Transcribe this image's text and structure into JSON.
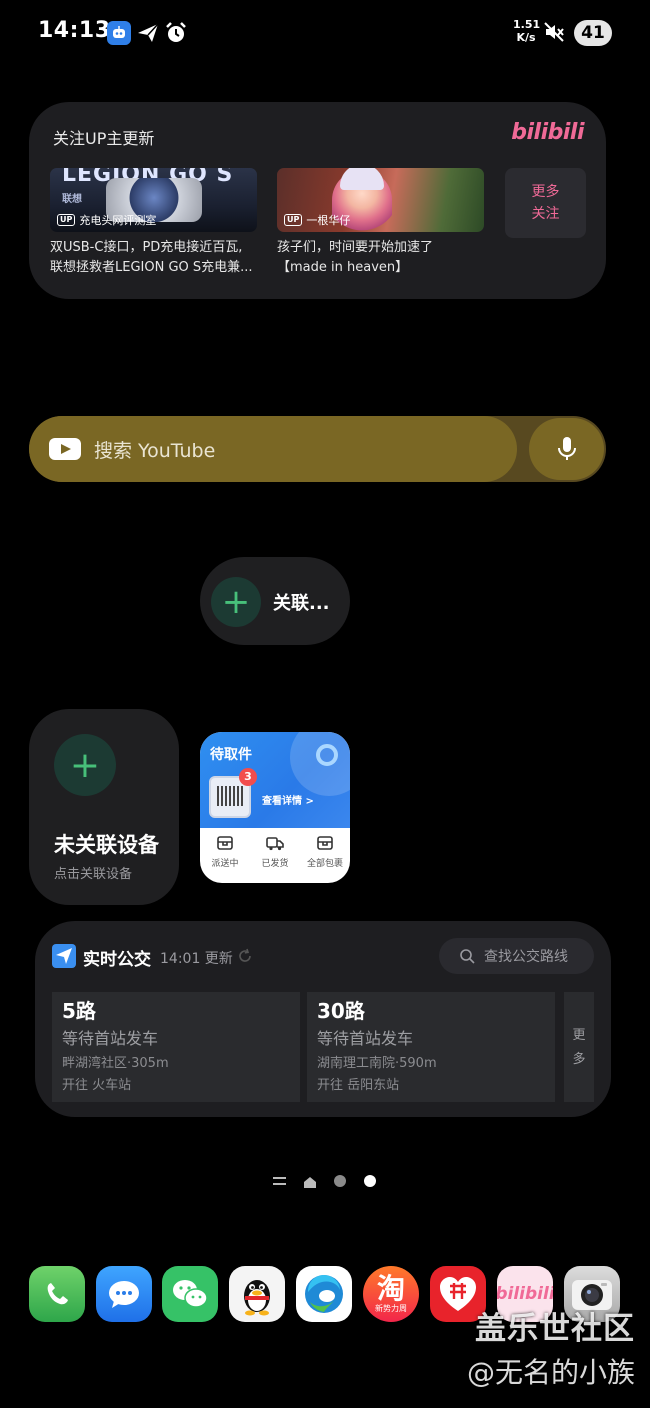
{
  "status_bar": {
    "time": "14:13",
    "speed_value": "1.51",
    "speed_unit": "K/s",
    "battery": "41"
  },
  "bilibili_widget": {
    "title": "关注UP主更新",
    "logo": "bilibili",
    "videos": [
      {
        "thumb_text": "LEGION GO S",
        "thumb_sub": "联想",
        "up_badge": "UP",
        "uploader": "充电头网评测室",
        "desc_line1": "双USB-C接口，PD充电接近百瓦,",
        "desc_line2": "联想拯救者LEGION GO S充电兼..."
      },
      {
        "up_badge": "UP",
        "uploader": "一根华仔",
        "desc_line1": "孩子们，时间要开始加速了",
        "desc_line2": "【made in heaven】"
      }
    ],
    "more_line1": "更多",
    "more_line2": "关注"
  },
  "youtube_widget": {
    "placeholder": "搜索 YouTube",
    "colors": {
      "bar": "#7a6724",
      "track": "#584920"
    }
  },
  "link_pill": {
    "label": "关联..."
  },
  "device_widget": {
    "title": "未关联设备",
    "subtitle": "点击关联设备"
  },
  "package_widget": {
    "title": "待取件",
    "count": "3",
    "detail": "查看详情 >",
    "tabs": [
      {
        "label": "派送中",
        "icon": "box-icon"
      },
      {
        "label": "已发货",
        "icon": "truck-icon"
      },
      {
        "label": "全部包裹",
        "icon": "package-icon"
      }
    ]
  },
  "bus_widget": {
    "title": "实时公交",
    "updated": "14:01 更新",
    "search_placeholder": "查找公交路线",
    "routes": [
      {
        "route": "5路",
        "status": "等待首站发车",
        "stop": "畔湖湾社区·305m",
        "direction": "开往 火车站"
      },
      {
        "route": "30路",
        "status": "等待首站发车",
        "stop": "湖南理工南院·590m",
        "direction": "开往 岳阳东站"
      }
    ],
    "more_line1": "更",
    "more_line2": "多"
  },
  "pager": {
    "pages": [
      "list",
      "home",
      "page-2",
      "page-3"
    ],
    "active_index": 3
  },
  "dock": {
    "apps": [
      {
        "name": "phone",
        "icon": "phone-icon"
      },
      {
        "name": "messages",
        "icon": "chat-bubble-icon"
      },
      {
        "name": "wechat",
        "icon": "wechat-icon"
      },
      {
        "name": "qq",
        "icon": "penguin-icon"
      },
      {
        "name": "edge",
        "icon": "edge-icon"
      },
      {
        "name": "taobao",
        "icon": "taobao-icon",
        "char": "淘",
        "sub": "新势力周"
      },
      {
        "name": "pinduoduo",
        "icon": "pinduoduo-icon"
      },
      {
        "name": "bilibili",
        "icon": "bilibili-icon",
        "text": "bilibili"
      },
      {
        "name": "camera",
        "icon": "camera-icon"
      }
    ]
  },
  "watermark": {
    "site": "盖乐世社区",
    "user": "@无名的小族"
  }
}
